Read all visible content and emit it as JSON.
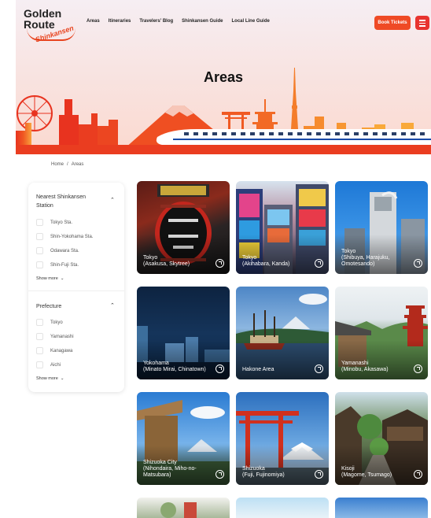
{
  "header": {
    "logo": {
      "line1": "Golden",
      "line2": "Route",
      "line3": "Shinkansen"
    },
    "nav": [
      "Areas",
      "Itineraries",
      "Travelers' Blog",
      "Shinkansen Guide",
      "Local Line Guide"
    ],
    "book_label": "Book Tickets"
  },
  "hero": {
    "title": "Areas"
  },
  "breadcrumb": {
    "home": "Home",
    "sep": "/",
    "current": "Areas"
  },
  "filters": {
    "station": {
      "title": "Nearest Shinkansen Station",
      "options": [
        "Tokyo Sta.",
        "Shin-Yokohama Sta.",
        "Odawara Sta.",
        "Shin-Fuji Sta."
      ],
      "show_more": "Show more"
    },
    "prefecture": {
      "title": "Prefecture",
      "options": [
        "Tokyo",
        "Yamanashi",
        "Kanagawa",
        "Aichi"
      ],
      "show_more": "Show more"
    }
  },
  "areas": [
    {
      "name": "Tokyo\n(Asakusa, Skytree)"
    },
    {
      "name": "Tokyo\n(Akihabara, Kanda)"
    },
    {
      "name": "Tokyo\n(Shibuya, Harajuku,\nOmotesando)"
    },
    {
      "name": "Yokohama\n(Minato Mirai, Chinatown)"
    },
    {
      "name": "Hakone Area"
    },
    {
      "name": "Yamanashi\n(Minobu, Akasawa)"
    },
    {
      "name": "Shizuoka City\n(Nihondaira, Miho-no-\nMatsubara)"
    },
    {
      "name": "Shizuoka\n(Fuji, Fujinomiya)"
    },
    {
      "name": "Kisoji\n(Magome, Tsumago)"
    }
  ]
}
